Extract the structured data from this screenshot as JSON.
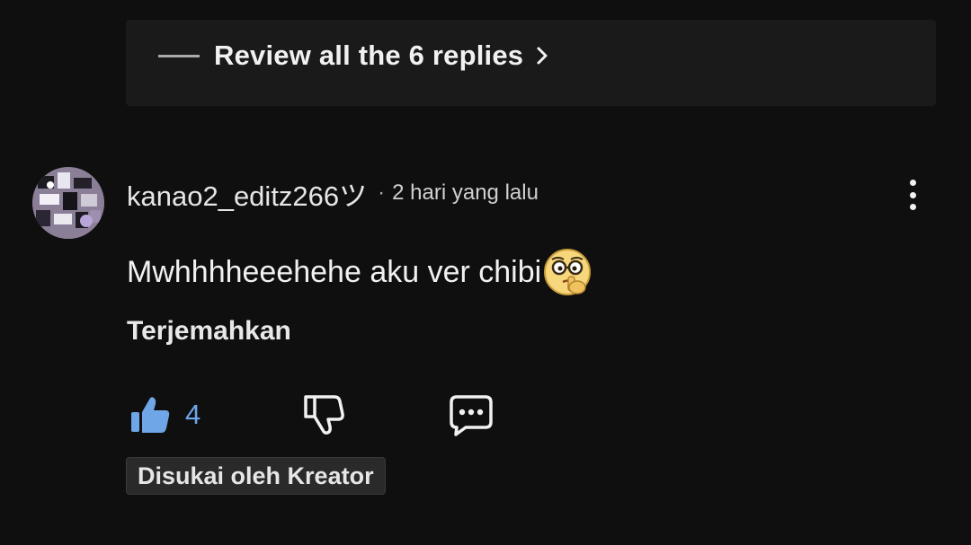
{
  "replies": {
    "label": "Review all the 6 replies"
  },
  "comment": {
    "author": "kanao2_editz266ツ",
    "separator": "·",
    "time": "2 hari yang lalu",
    "text": "Mwhhhheeehehe aku ver chibi",
    "emoji": "shushing-nerd-face-emoji",
    "translate_label": "Terjemahkan",
    "like_count": "4",
    "creator_badge": "Disukai oleh Kreator"
  },
  "colors": {
    "background": "#0f0f0f",
    "panel": "#1a1a1a",
    "like_accent": "#6fa6e8",
    "text": "#f1f1f1"
  }
}
